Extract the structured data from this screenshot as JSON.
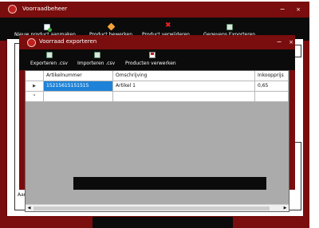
{
  "main_window": {
    "title": "Voorraadbeheer",
    "controls": {
      "minimize": "−",
      "close": "×"
    },
    "toolbar": [
      {
        "label": "Nieuw product aanmaken",
        "icon": "new-document-icon"
      },
      {
        "label": "Product bewerken",
        "icon": "pencil-icon"
      },
      {
        "label": "Product verwijderen",
        "icon": "delete-x-icon"
      },
      {
        "label": "Gegevens Exporteren",
        "icon": "export-icon"
      }
    ],
    "aangemaakt_label": "Aangemaakt:",
    "aangemaakt_value": "-"
  },
  "dialog": {
    "title": "Voorraad exporteren",
    "controls": {
      "minimize": "−",
      "close": "×"
    },
    "toolbar": [
      {
        "label": "Exporteren .csv",
        "icon": "export-csv-icon"
      },
      {
        "label": "Importeren .csv",
        "icon": "import-csv-icon"
      },
      {
        "label": "Producten verwerken",
        "icon": "save-icon"
      }
    ],
    "grid": {
      "columns": [
        "Artikelnummer",
        "Omschrijving",
        "Inkoopprijs"
      ],
      "rows": [
        {
          "indicator": "▶",
          "cells": [
            "15215615151515",
            "Artikel 1",
            "0,65"
          ]
        }
      ],
      "new_row_indicator": "*",
      "scroll_left": "◀",
      "scroll_right": "▶"
    }
  },
  "colors": {
    "window_frame": "#7a0d0d",
    "toolbar": "#0b0b0b",
    "selection": "#1e83d8"
  }
}
